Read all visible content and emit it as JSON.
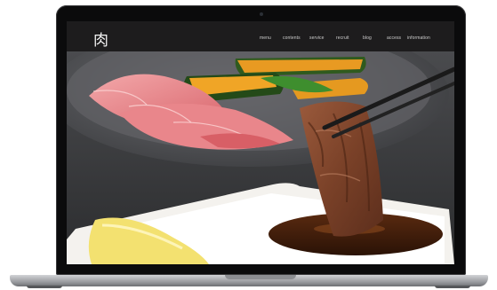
{
  "site": {
    "logo": "肉",
    "nav": [
      "menu",
      "contents",
      "service",
      "recruit",
      "blog",
      "access",
      "information"
    ]
  },
  "hero": {
    "image": "grilled-beef-with-sauce-photo"
  },
  "colors": {
    "header_bg": "#1d1c1d",
    "nav_text": "#cfcfcf",
    "bezel": "#0b0b0c"
  }
}
